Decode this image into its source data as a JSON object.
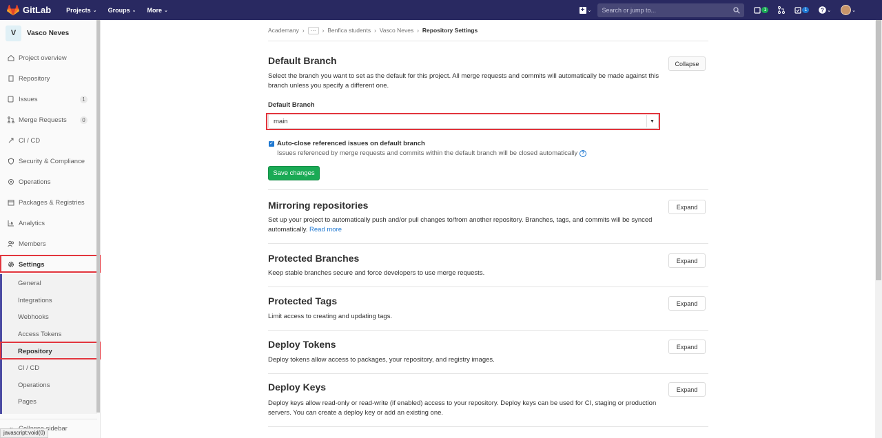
{
  "topbar": {
    "brand": "GitLab",
    "menus": [
      "Projects",
      "Groups",
      "More"
    ],
    "search_placeholder": "Search or jump to...",
    "todo_count": "1",
    "issues_count": "1"
  },
  "sidebar": {
    "project_initial": "V",
    "project_name": "Vasco Neves",
    "items": [
      {
        "label": "Project overview",
        "icon": "home-icon"
      },
      {
        "label": "Repository",
        "icon": "doc-icon"
      },
      {
        "label": "Issues",
        "icon": "issues-icon",
        "count": "1"
      },
      {
        "label": "Merge Requests",
        "icon": "merge-request-icon",
        "count": "0"
      },
      {
        "label": "CI / CD",
        "icon": "rocket-icon"
      },
      {
        "label": "Security & Compliance",
        "icon": "shield-icon"
      },
      {
        "label": "Operations",
        "icon": "cloud-gear-icon"
      },
      {
        "label": "Packages & Registries",
        "icon": "package-icon"
      },
      {
        "label": "Analytics",
        "icon": "chart-icon"
      },
      {
        "label": "Members",
        "icon": "users-icon"
      },
      {
        "label": "Settings",
        "icon": "gear-icon"
      }
    ],
    "sub_items": [
      "General",
      "Integrations",
      "Webhooks",
      "Access Tokens",
      "Repository",
      "CI / CD",
      "Operations",
      "Pages"
    ],
    "collapse_label": "Collapse sidebar"
  },
  "status_bar": "javascript:void(0)",
  "breadcrumb": [
    "Academany",
    "Benfica students",
    "Vasco Neves",
    "Repository Settings"
  ],
  "default_branch": {
    "title": "Default Branch",
    "description": "Select the branch you want to set as the default for this project. All merge requests and commits will automatically be made against this branch unless you specify a different one.",
    "button": "Collapse",
    "field_label": "Default Branch",
    "selected": "main",
    "checkbox_label": "Auto-close referenced issues on default branch",
    "checkbox_checked": true,
    "checkbox_help": "Issues referenced by merge requests and commits within the default branch will be closed automatically",
    "save_label": "Save changes"
  },
  "sections": [
    {
      "title": "Mirroring repositories",
      "description": "Set up your project to automatically push and/or pull changes to/from another repository. Branches, tags, and commits will be synced automatically.",
      "link": "Read more",
      "button": "Expand"
    },
    {
      "title": "Protected Branches",
      "description": "Keep stable branches secure and force developers to use merge requests.",
      "button": "Expand"
    },
    {
      "title": "Protected Tags",
      "description": "Limit access to creating and updating tags.",
      "button": "Expand"
    },
    {
      "title": "Deploy Tokens",
      "description": "Deploy tokens allow access to packages, your repository, and registry images.",
      "button": "Expand"
    },
    {
      "title": "Deploy Keys",
      "description": "Deploy keys allow read-only or read-write (if enabled) access to your repository. Deploy keys can be used for CI, staging or production servers. You can create a deploy key or add an existing one.",
      "button": "Expand"
    }
  ]
}
